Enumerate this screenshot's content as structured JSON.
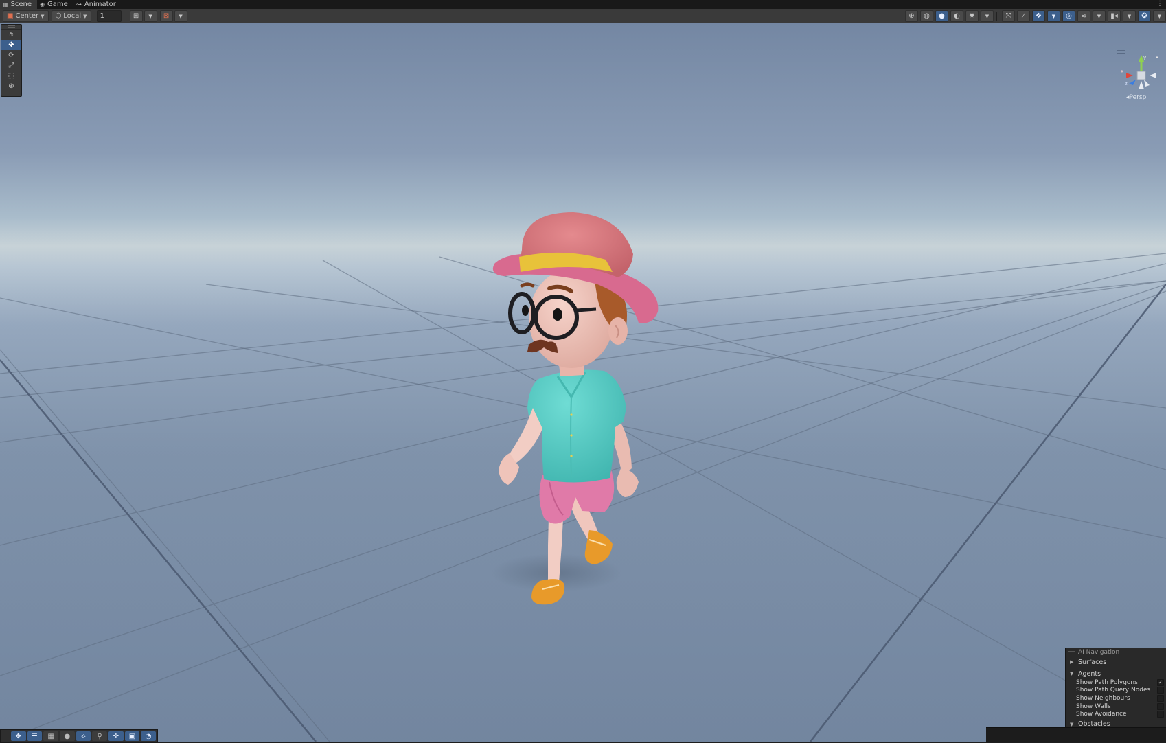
{
  "tabs": [
    {
      "label": "Scene",
      "icon": "scene-icon"
    },
    {
      "label": "Game",
      "icon": "gamepad-icon"
    },
    {
      "label": "Animator",
      "icon": "animator-icon"
    }
  ],
  "toolbar": {
    "pivot_mode": "Center",
    "pivot_rotation": "Local",
    "increment_value": "1"
  },
  "tools": [
    "hand-tool",
    "move-tool",
    "rotate-tool",
    "scale-tool",
    "rect-tool",
    "transform-tool"
  ],
  "selected_tool": "move-tool",
  "gizmo": {
    "projection_label": "Persp",
    "axes": {
      "x": "x",
      "y": "y",
      "z": "z"
    },
    "colors": {
      "x": "#e0463b",
      "y": "#8fd14f",
      "z": "#3a7de0"
    }
  },
  "ai_navigation": {
    "title": "AI Navigation",
    "surfaces_label": "Surfaces",
    "agents_label": "Agents",
    "obstacles_label": "Obstacles",
    "options": [
      {
        "label": "Show Path Polygons",
        "checked": true
      },
      {
        "label": "Show Path Query Nodes",
        "checked": false
      },
      {
        "label": "Show Neighbours",
        "checked": false
      },
      {
        "label": "Show Walls",
        "checked": false
      },
      {
        "label": "Show Avoidance",
        "checked": false
      }
    ]
  },
  "character_colors": {
    "hat": "#d9767c",
    "hat_band": "#e8c23a",
    "shirt": "#5ecfc8",
    "shorts": "#e07aa8",
    "skin": "#f0c6bd",
    "hair": "#a85a2a",
    "shoes": "#e89a2a",
    "glasses": "#1e1e22"
  }
}
